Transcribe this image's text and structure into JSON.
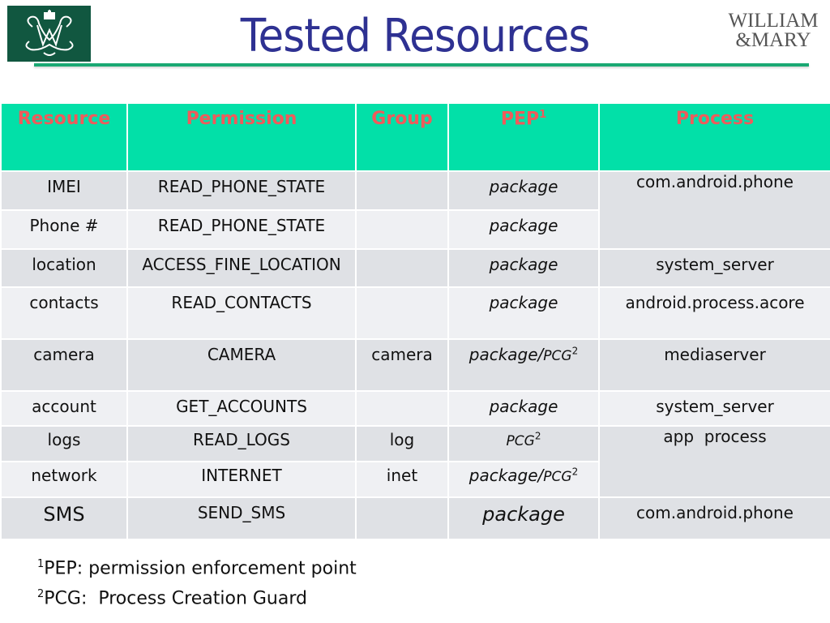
{
  "slide": {
    "title": "Tested Resources",
    "logo_left": "cypher-crown-icon",
    "logo_right_line1": "WILLIAM",
    "logo_right_line2": "&MARY"
  },
  "table": {
    "headers": {
      "resource": "Resource",
      "permission": "Permission",
      "group": "Group",
      "pep": "PEP",
      "pep_sup": "1",
      "process": "Process"
    },
    "rows": [
      {
        "resource": "IMEI",
        "permission": "READ_PHONE_STATE",
        "group": "",
        "pep": "package",
        "pcg": "",
        "pcg_sup": "",
        "process": "com.android.phone"
      },
      {
        "resource": "Phone #",
        "permission": "READ_PHONE_STATE",
        "group": "",
        "pep": "package",
        "pcg": "",
        "pcg_sup": "",
        "process": ""
      },
      {
        "resource": "location",
        "permission": "ACCESS_FINE_LOCATION",
        "group": "",
        "pep": "package",
        "pcg": "",
        "pcg_sup": "",
        "process": "system_server"
      },
      {
        "resource": "contacts",
        "permission": "READ_CONTACTS",
        "group": "",
        "pep": "package",
        "pcg": "",
        "pcg_sup": "",
        "process": "android.process.acore"
      },
      {
        "resource": "camera",
        "permission": "CAMERA",
        "group": "camera",
        "pep": "package/",
        "pcg": "PCG",
        "pcg_sup": "2",
        "process": "mediaserver"
      },
      {
        "resource": "account",
        "permission": "GET_ACCOUNTS",
        "group": "",
        "pep": "package",
        "pcg": "",
        "pcg_sup": "",
        "process": "system_server"
      },
      {
        "resource": "logs",
        "permission": "READ_LOGS",
        "group": "log",
        "pep": "",
        "pcg": "PCG",
        "pcg_sup": "2",
        "process": "app  process"
      },
      {
        "resource": "network",
        "permission": "INTERNET",
        "group": "inet",
        "pep": "package/",
        "pcg": "PCG",
        "pcg_sup": "2",
        "process": ""
      },
      {
        "resource": "SMS",
        "permission": "SEND_SMS",
        "group": "",
        "pep": "package",
        "pcg": "",
        "pcg_sup": "",
        "process": "com.android.phone"
      }
    ]
  },
  "footnotes": [
    {
      "sup": "1",
      "text": "PEP: permission enforcement point"
    },
    {
      "sup": "2",
      "text": "PCG:  Process Creation Guard"
    }
  ]
}
